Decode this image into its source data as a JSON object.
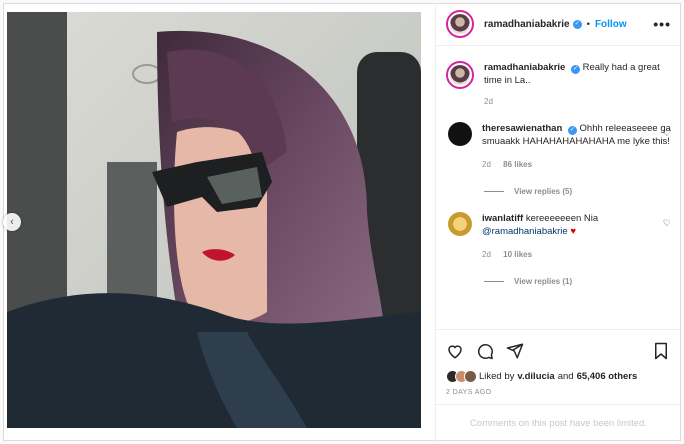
{
  "post": {
    "author": "ramadhaniabakrie",
    "dot": "•",
    "follow_label": "Follow",
    "more_label": "•••",
    "nav_prev": "‹"
  },
  "comments": [
    {
      "user": "ramadhaniabakrie",
      "verified": true,
      "text": "Really had a great time in La..",
      "time": "2d",
      "likes": "",
      "replies": ""
    },
    {
      "user": "theresawienathan",
      "verified": true,
      "text": "Ohhh releeaseeee ga smuaakk HAHAHAHAHAHAHA me lyke this!",
      "time": "2d",
      "likes": "86 likes",
      "replies": "View replies (5)"
    },
    {
      "user": "iwanlatiff",
      "verified": false,
      "text": "kereeeeeeen Nia",
      "mention": "@ramadhaniabakrie",
      "heart": "♥",
      "time": "2d",
      "likes": "10 likes",
      "replies": "View replies (1)"
    }
  ],
  "icons": {
    "like": "heart-icon",
    "comment": "comment-icon",
    "share": "share-icon",
    "save": "bookmark-icon"
  },
  "likes": {
    "prefix": "Liked by",
    "user": "v.dilucia",
    "and": "and",
    "count": "65,406 others"
  },
  "date": "2 DAYS AGO",
  "limited_text": "Comments on this post have been limited.",
  "colors": {
    "accent": "#0095f6",
    "verified": "#3897f0",
    "heart_red": "#dd0000"
  }
}
